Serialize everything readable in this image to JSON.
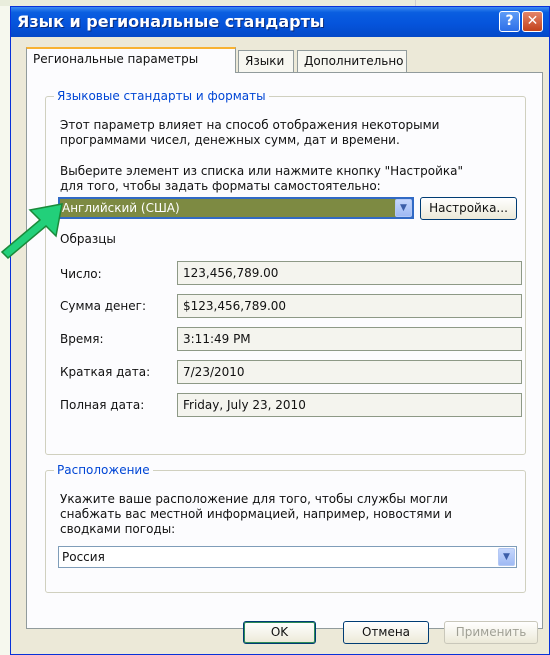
{
  "window": {
    "title": "Язык и региональные стандарты",
    "help_glyph": "?",
    "close_glyph": "✕"
  },
  "tabs": [
    {
      "label": "Региональные параметры"
    },
    {
      "label": "Языки"
    },
    {
      "label": "Дополнительно"
    }
  ],
  "formats": {
    "legend": "Языковые стандарты и форматы",
    "desc_line1": "Этот параметр влияет на способ отображения некоторыми",
    "desc_line2": "программами чисел, денежных сумм, дат и времени.",
    "select_line1": "Выберите элемент из списка или нажмите кнопку \"Настройка\"",
    "select_line2": "для того, чтобы задать форматы самостоятельно:",
    "locale_value": "Английский (США)",
    "customize_label": "Настройка...",
    "samples_title": "Образцы",
    "samples": [
      {
        "label": "Число:",
        "value": "123,456,789.00"
      },
      {
        "label": "Сумма денег:",
        "value": "$123,456,789.00"
      },
      {
        "label": "Время:",
        "value": "3:11:49 PM"
      },
      {
        "label": "Краткая дата:",
        "value": "7/23/2010"
      },
      {
        "label": "Полная дата:",
        "value": "Friday, July 23, 2010"
      }
    ]
  },
  "location": {
    "legend": "Расположение",
    "desc_line1": "Укажите ваше расположение для того, чтобы службы могли",
    "desc_line2": "снабжать вас местной информацией, например, новостями и",
    "desc_line3": "сводками погоды:",
    "value": "Россия"
  },
  "footer": {
    "ok_label": "OK",
    "cancel_label": "Отмена",
    "apply_label": "Применить"
  },
  "colors": {
    "arrow": "#22d07a",
    "selection": "#316ac5",
    "legend_text": "#0046d5"
  }
}
